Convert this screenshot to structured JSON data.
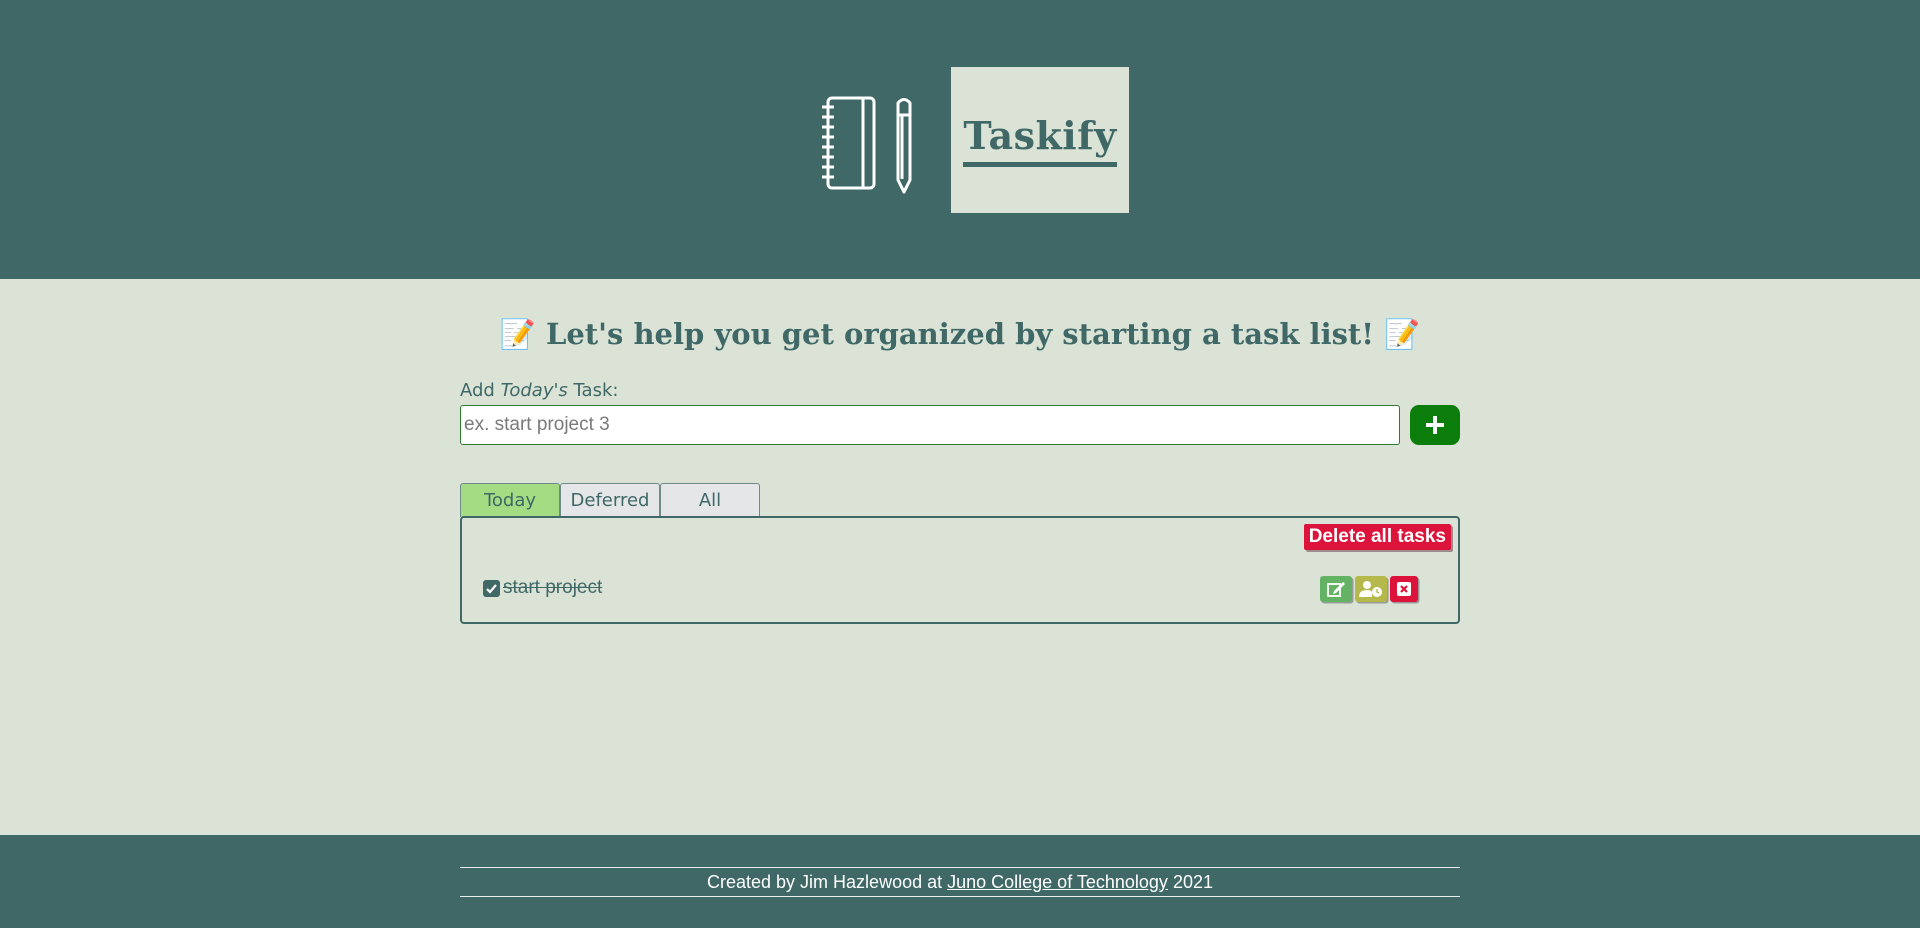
{
  "header": {
    "logo_icon": "notebook-pencil-icon",
    "title": "Taskify"
  },
  "main": {
    "headline_emoji": "📝",
    "headline": "Let's help you get organized by starting a task list!",
    "add_label": {
      "prefix": "Add ",
      "emphasis": "Today's",
      "suffix": " Task:"
    },
    "input_placeholder": "ex. start project 3",
    "input_value": "",
    "add_button_icon": "plus-icon"
  },
  "tabs": [
    {
      "label": "Today",
      "active": true
    },
    {
      "label": "Deferred",
      "active": false
    },
    {
      "label": "All",
      "active": false
    }
  ],
  "panel": {
    "delete_all_label": "Delete all tasks",
    "tasks": [
      {
        "text": "start project",
        "completed": true,
        "actions": [
          "edit-icon",
          "defer-user-clock-icon",
          "delete-x-icon"
        ]
      }
    ]
  },
  "footer": {
    "prefix": "Created by Jim Hazlewood at ",
    "link_text": "Juno College of Technology",
    "suffix": " 2021"
  },
  "colors": {
    "primary": "#3f6867",
    "background": "#dae3d6",
    "add_button": "#0a7d0a",
    "active_tab": "#a4dc84",
    "danger": "#dc143c",
    "edit": "#64b264",
    "defer": "#b5b84a"
  }
}
